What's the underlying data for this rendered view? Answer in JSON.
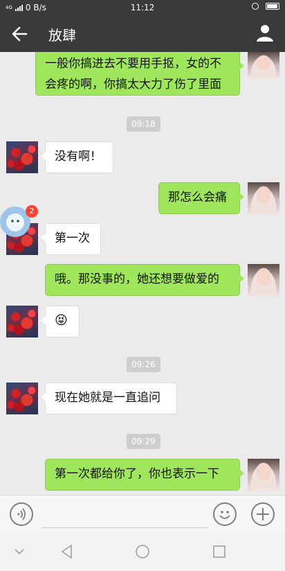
{
  "status_bar": {
    "network": "4G",
    "speed": "0 B/s",
    "time": "11:12"
  },
  "header": {
    "title": "放肆"
  },
  "messages": [
    {
      "side": "out",
      "lines": [
        "一般你搞进去不要用手抠，女的不",
        "会疼的啊，你搞太大力了伤了里面"
      ]
    },
    {
      "side": "out",
      "text": "那怎么会痛"
    },
    {
      "side": "in",
      "text": "没有啊！"
    },
    {
      "side": "in",
      "text": "第一次"
    },
    {
      "side": "out",
      "text": "哦。那没事的，她还想要做爱的"
    },
    {
      "side": "in",
      "emoji": "😝"
    },
    {
      "side": "in",
      "text": "现在她就是一直追问"
    },
    {
      "side": "out",
      "text": "第一次都给你了，你也表示一下"
    }
  ],
  "timestamps": [
    "09:18",
    "09:26",
    "09:29"
  ],
  "floating_ball": {
    "badge_count": "2"
  },
  "input_bar": {
    "placeholder": ""
  },
  "colors": {
    "header_bg": "#3a3a3a",
    "chat_bg": "#ebebeb",
    "outgoing_bubble": "#9fe65c",
    "incoming_bubble": "#ffffff",
    "badge": "#f4433a"
  }
}
